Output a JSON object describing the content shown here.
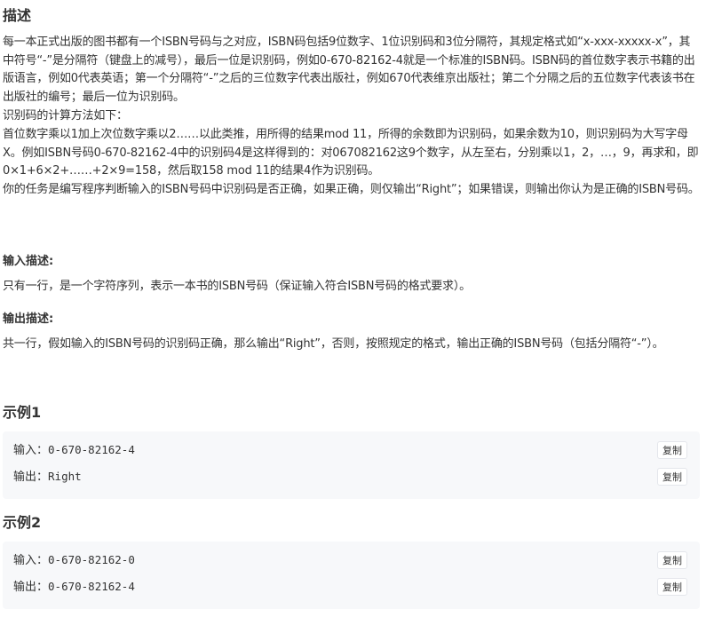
{
  "description": {
    "title": "描述",
    "paragraphs": [
      "每一本正式出版的图书都有一个ISBN号码与之对应，ISBN码包括9位数字、1位识别码和3位分隔符，其规定格式如“x-xxx-xxxxx-x”，其中符号“-”是分隔符（键盘上的减号），最后一位是识别码，例如0-670-82162-4就是一个标准的ISBN码。ISBN码的首位数字表示书籍的出版语言，例如0代表英语；第一个分隔符“-”之后的三位数字代表出版社，例如670代表维京出版社；第二个分隔之后的五位数字代表该书在出版社的编号；最后一位为识别码。",
      "识别码的计算方法如下：",
      "首位数字乘以1加上次位数字乘以2……以此类推，用所得的结果mod 11，所得的余数即为识别码，如果余数为10，则识别码为大写字母X。例如ISBN号码0-670-82162-4中的识别码4是这样得到的：对067082162这9个数字，从左至右，分别乘以1，2，…，9，再求和，即0×1+6×2+……+2×9=158，然后取158 mod 11的结果4作为识别码。",
      "你的任务是编写程序判断输入的ISBN号码中识别码是否正确，如果正确，则仅输出“Right”；如果错误，则输出你认为是正确的ISBN号码。"
    ]
  },
  "input_desc": {
    "title": "输入描述:",
    "text": "只有一行，是一个字符序列，表示一本书的ISBN号码（保证输入符合ISBN号码的格式要求）。"
  },
  "output_desc": {
    "title": "输出描述:",
    "text": "共一行，假如输入的ISBN号码的识别码正确，那么输出“Right”，否则，按照规定的格式，输出正确的ISBN号码（包括分隔符“-”）。"
  },
  "examples": [
    {
      "title": "示例1",
      "input_label": "输入：",
      "input_value": "0-670-82162-4",
      "output_label": "输出：",
      "output_value": "Right",
      "copy_label": "复制"
    },
    {
      "title": "示例2",
      "input_label": "输入：",
      "input_value": "0-670-82162-0",
      "output_label": "输出：",
      "output_value": "0-670-82162-4",
      "copy_label": "复制"
    }
  ]
}
